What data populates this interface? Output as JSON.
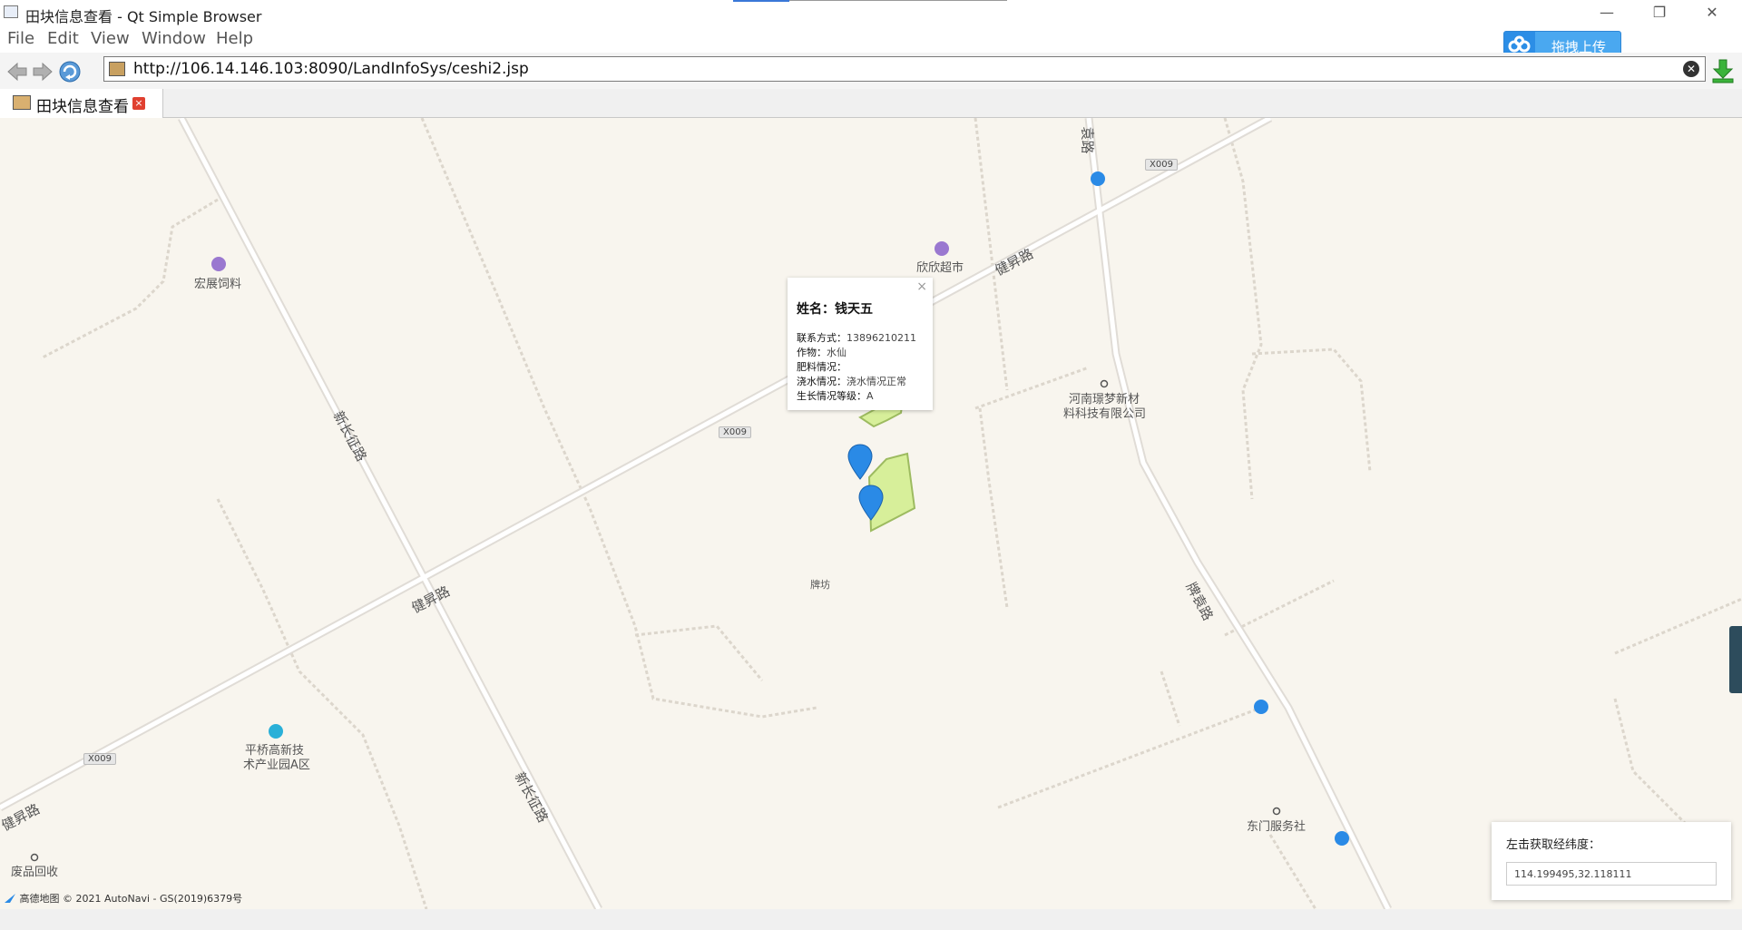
{
  "window": {
    "title": "田块信息查看 - Qt Simple Browser",
    "minimize": "—",
    "restore": "❐",
    "close": "✕"
  },
  "menu": [
    "File",
    "Edit",
    "View",
    "Window",
    "Help"
  ],
  "upload": {
    "label": "拖拽上传"
  },
  "toolbar": {
    "url": "http://106.14.146.103:8090/LandInfoSys/ceshi2.jsp",
    "clear": "✕"
  },
  "tab": {
    "label": "田块信息查看",
    "close": "×"
  },
  "map": {
    "roads": {
      "jiansheng": "健昇路",
      "xinchangzheng": "新长征路",
      "paiyuan": "牌袁路",
      "yuan": "袁路"
    },
    "road_code": "X009",
    "pois": {
      "hongzhan": "宏展饲料",
      "xinxin": "欣欣超市",
      "henan": "河南璟梦新材",
      "henan2": "料科技有限公司",
      "paifang": "牌坊",
      "pingqiao": "平桥高新技",
      "pingqiao2": "术产业园A区",
      "feipin": "废品回收",
      "dongmen": "东门服务社"
    },
    "copyright": "高德地图 © 2021 AutoNavi - GS(2019)6379号"
  },
  "popup": {
    "name": "姓名：钱天五",
    "close": "×",
    "contact_label": "联系方式：",
    "contact_value": "13896210211",
    "crop_label": "作物：",
    "crop_value": "水仙",
    "fertilizer_label": "肥料情况：",
    "fertilizer_value": "",
    "water_label": "浇水情况：",
    "water_value": "浇水情况正常",
    "growth_label": "生长情况等级：",
    "growth_value": "A"
  },
  "coord_panel": {
    "label": "左击获取经纬度：",
    "value": "114.199495,32.118111"
  },
  "colors": {
    "field_fill": "#d7ef9a",
    "marker": "#2a8ae6",
    "upload": "#4aa8f0",
    "map_bg": "#f8f5ee"
  }
}
